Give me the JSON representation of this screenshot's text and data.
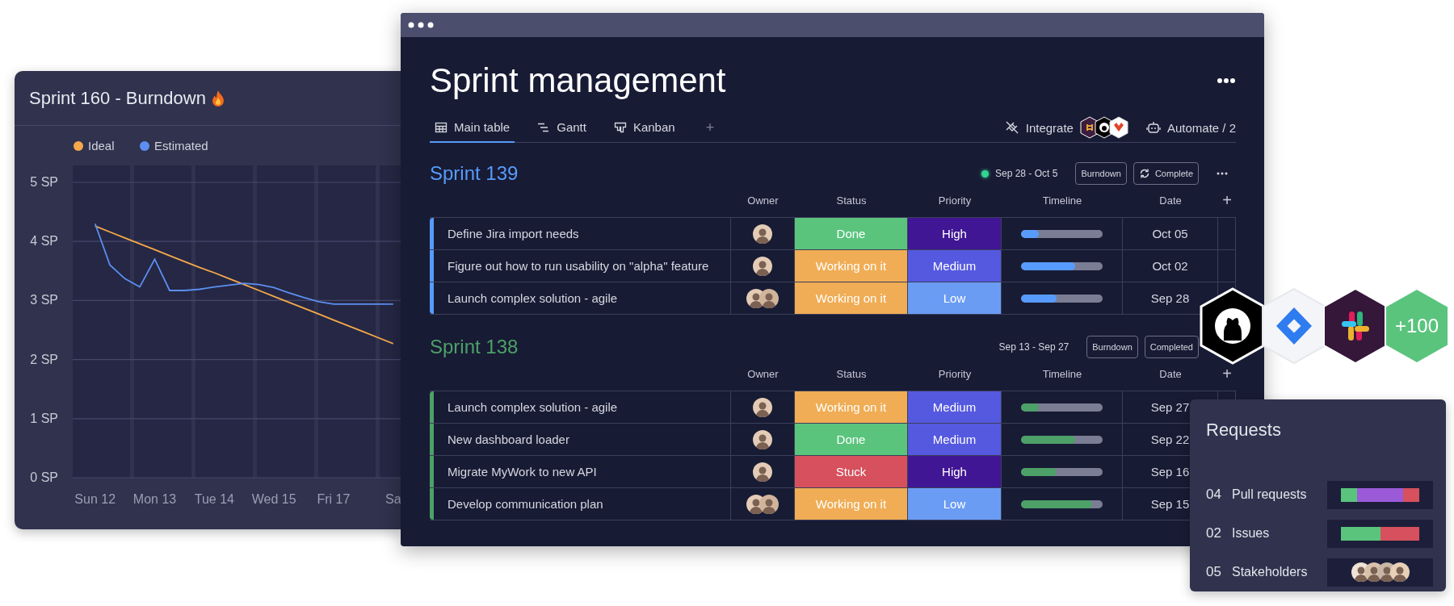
{
  "burndown": {
    "title": "Sprint 160 - Burndown",
    "chart_data": {
      "type": "line",
      "categories": [
        null,
        "Sun 12",
        null,
        null,
        null,
        "Mon 13",
        null,
        null,
        null,
        "Tue 14",
        null,
        null,
        null,
        "Wed 15",
        null,
        null,
        null,
        "Fri 17",
        null,
        null,
        null,
        "Sa"
      ],
      "series": [
        {
          "name": "Ideal",
          "color": "#f5a94a",
          "values": [
            null,
            4.26,
            4.16,
            4.06,
            3.96,
            3.86,
            3.76,
            3.66,
            3.56,
            3.47,
            3.37,
            3.27,
            3.17,
            3.07,
            2.97,
            2.87,
            2.77,
            2.67,
            2.57,
            2.47,
            2.37,
            2.27
          ]
        },
        {
          "name": "Estimated",
          "color": "#5c8ff0",
          "values": [
            null,
            4.3,
            3.6,
            3.37,
            3.23,
            3.7,
            3.17,
            3.17,
            3.19,
            3.23,
            3.26,
            3.29,
            3.27,
            3.22,
            3.13,
            3.05,
            2.98,
            2.94,
            2.94,
            2.94,
            2.94,
            2.94
          ]
        }
      ],
      "ylim": [
        0,
        5
      ],
      "grid": true,
      "legend": "top",
      "yticks": [
        {
          "value": 0,
          "label": "0 SP"
        },
        {
          "value": 1,
          "label": "1 SP"
        },
        {
          "value": 2,
          "label": "2 SP"
        },
        {
          "value": 3,
          "label": "3 SP"
        },
        {
          "value": 4,
          "label": "4 SP"
        },
        {
          "value": 5,
          "label": "5 SP"
        }
      ]
    }
  },
  "board": {
    "title": "Sprint management",
    "views": [
      {
        "label": "Main table",
        "kind": "table",
        "selected": true
      },
      {
        "label": "Gantt",
        "kind": "gantt",
        "selected": false
      },
      {
        "label": "Kanban",
        "kind": "kanban",
        "selected": false
      }
    ],
    "add_view": "+",
    "integrate": "Integrate",
    "automate": "Automate / 2",
    "groups": [
      {
        "name": "Sprint 139",
        "color": "#579bfc",
        "active": true,
        "menu": true,
        "dates": "Sep 28 - Oct 5",
        "buttons": [
          {
            "label": "Burndown",
            "kind": "plain"
          },
          {
            "label": "Complete",
            "kind": "sync"
          }
        ],
        "columns": [
          "Owner",
          "Status",
          "Priority",
          "Timeline",
          "Date"
        ],
        "add_column": "+",
        "rows": [
          {
            "name": "Define Jira import needs",
            "owners": [
              {
                "kind": "avatar"
              }
            ],
            "status": {
              "label": "Done",
              "color": "#5ac47d"
            },
            "priority": {
              "label": "High",
              "color": "#401694"
            },
            "level": 0.22,
            "date": "Oct 05"
          },
          {
            "name": "Figure out how to run usability on \"alpha\" feature",
            "owners": [
              {
                "kind": "avatar"
              }
            ],
            "status": {
              "label": "Working on it",
              "color": "#f0ad55"
            },
            "priority": {
              "label": "Medium",
              "color": "#5559df"
            },
            "level": 0.66,
            "date": "Oct 02"
          },
          {
            "name": "Launch complex solution - agile",
            "owners": [
              {
                "kind": "avatar"
              },
              {
                "kind": "avatar"
              }
            ],
            "status": {
              "label": "Working on it",
              "color": "#f0ad55"
            },
            "priority": {
              "label": "Low",
              "color": "#6a9cf4"
            },
            "level": 0.44,
            "date": "Sep 28"
          }
        ]
      },
      {
        "name": "Sprint 138",
        "color": "#4da068",
        "active": false,
        "menu": false,
        "dates": "Sep 13 - Sep 27",
        "buttons": [
          {
            "label": "Burndown",
            "kind": "plain"
          },
          {
            "label": "Completed",
            "kind": "plain"
          }
        ],
        "columns": [
          "Owner",
          "Status",
          "Priority",
          "Timeline",
          "Date"
        ],
        "add_column": "+",
        "rows": [
          {
            "name": "Launch complex solution - agile",
            "owners": [
              {
                "kind": "avatar"
              }
            ],
            "status": {
              "label": "Working on it",
              "color": "#f0ad55"
            },
            "priority": {
              "label": "Medium",
              "color": "#5559df"
            },
            "level": 0.22,
            "date": "Sep 27"
          },
          {
            "name": "New dashboard loader",
            "owners": [
              {
                "kind": "avatar"
              }
            ],
            "status": {
              "label": "Done",
              "color": "#5ac47d"
            },
            "priority": {
              "label": "Medium",
              "color": "#5559df"
            },
            "level": 0.66,
            "date": "Sep 22"
          },
          {
            "name": "Migrate MyWork to new API",
            "owners": [
              {
                "kind": "avatar"
              }
            ],
            "status": {
              "label": "Stuck",
              "color": "#d6505d"
            },
            "priority": {
              "label": "High",
              "color": "#401694"
            },
            "level": 0.44,
            "date": "Sep 16"
          },
          {
            "name": "Develop communication plan",
            "owners": [
              {
                "kind": "avatar"
              },
              {
                "kind": "avatar"
              }
            ],
            "status": {
              "label": "Working on it",
              "color": "#f0ad55"
            },
            "priority": {
              "label": "Low",
              "color": "#6a9cf4"
            },
            "level": 0.87,
            "date": "Sep 15"
          }
        ]
      }
    ]
  },
  "integrations": [
    {
      "kind": "cat"
    },
    {
      "kind": "diamond"
    },
    {
      "kind": "hash"
    },
    {
      "kind": "more",
      "label": "+100"
    }
  ],
  "requests": {
    "title": "Requests",
    "rows": [
      {
        "count": "04",
        "label": "Pull requests",
        "kind": "bar",
        "segments": [
          {
            "color": "#5ac47d",
            "level": 0.21
          },
          {
            "color": "#9b5bd9",
            "level": 0.79
          },
          {
            "color": "#d6505d",
            "level": 1
          }
        ]
      },
      {
        "count": "02",
        "label": "Issues",
        "kind": "bar",
        "segments": [
          {
            "color": "#5ac47d",
            "level": 0.5
          },
          {
            "color": "#d6505d",
            "level": 1
          }
        ]
      },
      {
        "count": "05",
        "label": "Stakeholders",
        "kind": "avatars"
      }
    ]
  }
}
